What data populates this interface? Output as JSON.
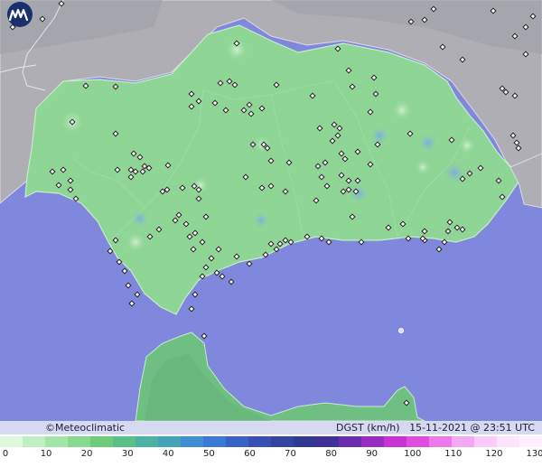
{
  "brand": {
    "name": "©Meteoclimatic"
  },
  "status": {
    "label": "DGST (km/h)",
    "datetime": "15-11-2021 @ 23:51 UTC"
  },
  "scale": {
    "ticks": [
      "0",
      "10",
      "20",
      "30",
      "40",
      "50",
      "60",
      "70",
      "80",
      "90",
      "100",
      "110",
      "120",
      "130"
    ],
    "colors": [
      "#ddf8dd",
      "#c0f0c2",
      "#a4e6a8",
      "#86d98d",
      "#6ccc7a",
      "#58c088",
      "#4cb2a2",
      "#45a2bb",
      "#3f8fd2",
      "#3a79d6",
      "#3862c8",
      "#3650b4",
      "#3444a2",
      "#303a90",
      "#40309a",
      "#6a2cb0",
      "#9a2cc6",
      "#c832d6",
      "#e04ce0",
      "#ec78ec",
      "#f4a8f4",
      "#faccfa",
      "#fde4fd",
      "#fff0ff"
    ]
  },
  "colors": {
    "sea": "#7f88dd",
    "land": "#8fd596",
    "neighbour_land": "#aeaeb4",
    "station_marker": "#222222"
  },
  "map": {
    "region": "Andalucía",
    "features": [
      "land-andalusia-icon",
      "land-north-africa-icon",
      "neighbour-portugal-icon",
      "neighbour-spain-icon"
    ]
  }
}
